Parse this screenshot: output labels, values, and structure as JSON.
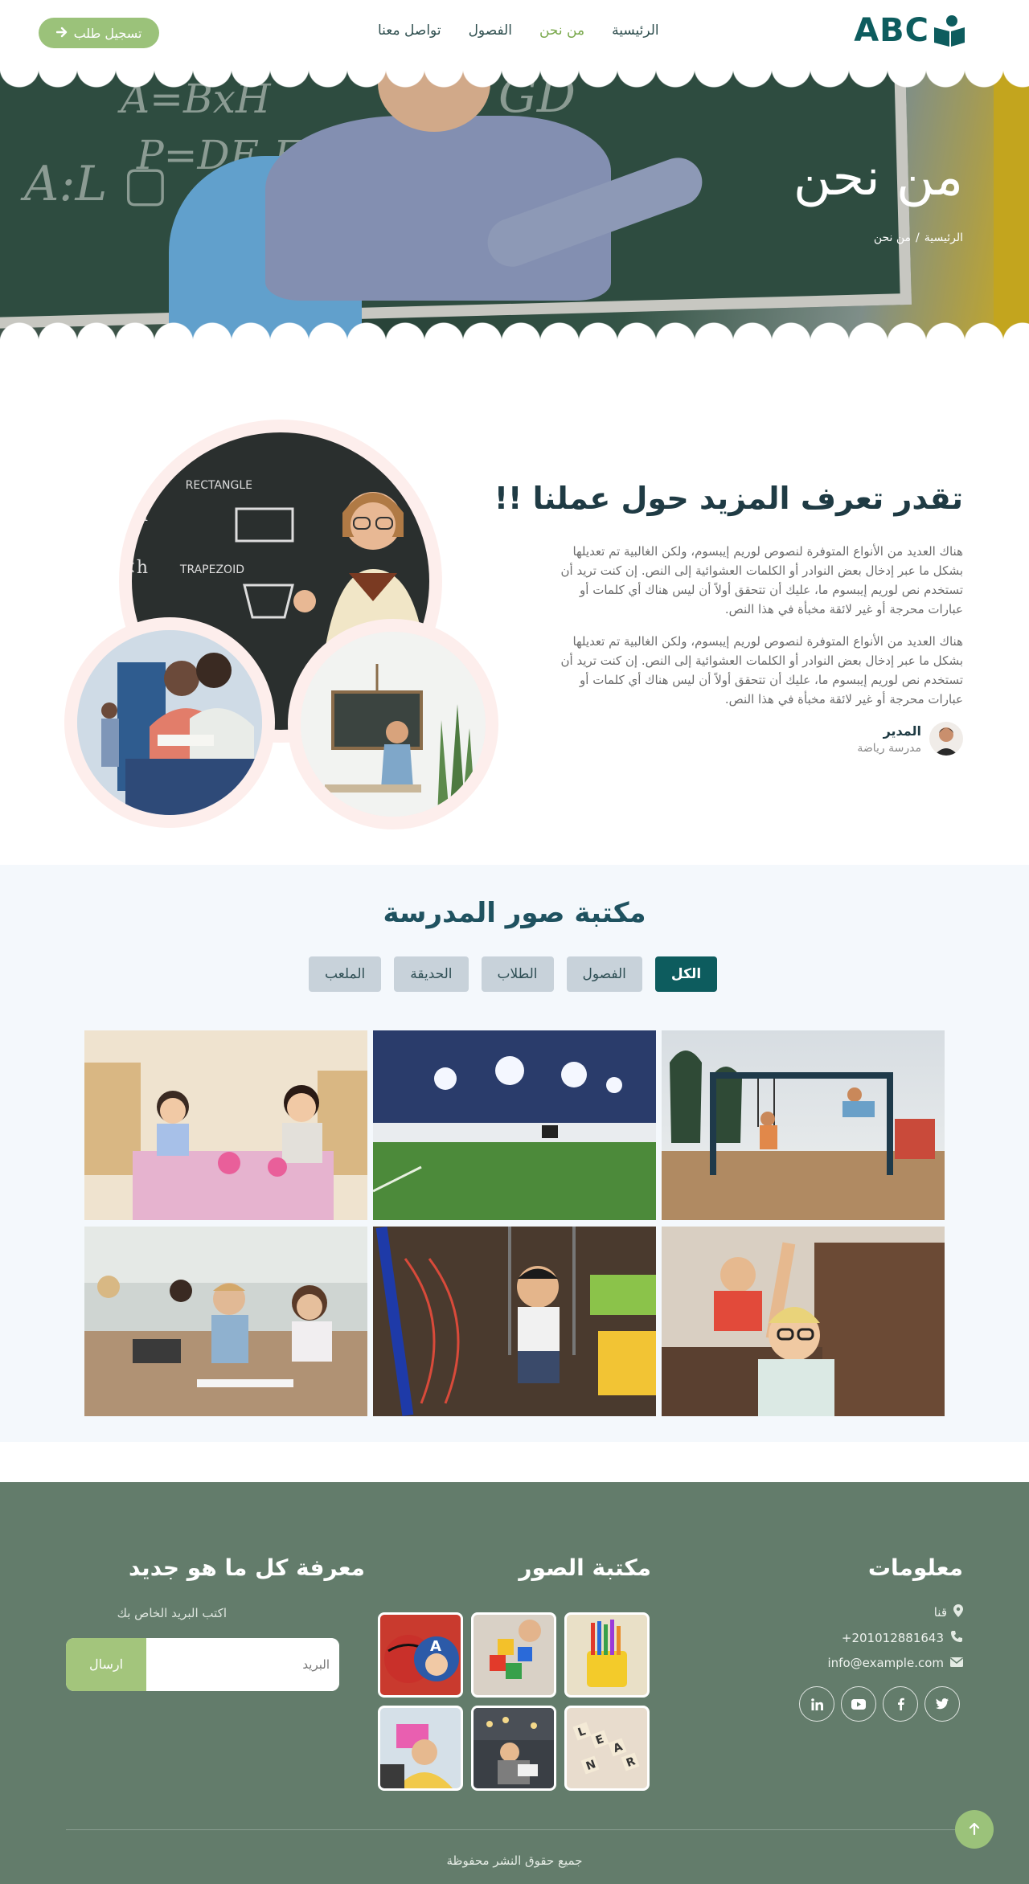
{
  "nav": {
    "logo_text": "ABC",
    "items": [
      {
        "label": "الرئيسية",
        "active": false
      },
      {
        "label": "من نحن",
        "active": true
      },
      {
        "label": "الفصول",
        "active": false
      },
      {
        "label": "تواصل معنا",
        "active": false
      }
    ],
    "cta_label": "تسجيل طلب"
  },
  "hero": {
    "title": "من نحن",
    "breadcrumb": {
      "home": "الرئيسية",
      "separator": "/",
      "current": "من نحن"
    }
  },
  "about": {
    "title": "تقدر تعرف المزيد حول عملنا !!",
    "paragraphs": [
      "هناك العديد من الأنواع المتوفرة لنصوص لوريم إيبسوم، ولكن الغالبية تم تعديلها بشكل ما عبر إدخال بعض النوادر أو الكلمات العشوائية إلى النص. إن كنت تريد أن تستخدم نص لوريم إيبسوم ما، عليك أن تتحقق أولاً أن ليس هناك أي كلمات أو عبارات محرجة أو غير لائقة مخبأة في هذا النص.",
      "هناك العديد من الأنواع المتوفرة لنصوص لوريم إيبسوم، ولكن الغالبية تم تعديلها بشكل ما عبر إدخال بعض النوادر أو الكلمات العشوائية إلى النص. إن كنت تريد أن تستخدم نص لوريم إيبسوم ما، عليك أن تتحقق أولاً أن ليس هناك أي كلمات أو عبارات محرجة أو غير لائقة مخبأة في هذا النص."
    ],
    "manager": {
      "name": "المدير",
      "role": "مدرسة رياضة"
    }
  },
  "gallery": {
    "title": "مكتبة صور المدرسة",
    "filters": [
      {
        "label": "الكل",
        "active": true
      },
      {
        "label": "الفصول",
        "active": false
      },
      {
        "label": "الطلاب",
        "active": false
      },
      {
        "label": "الحديقة",
        "active": false
      },
      {
        "label": "الملعب",
        "active": false
      }
    ]
  },
  "footer": {
    "info": {
      "title": "معلومات",
      "address": "قنا",
      "phone": "+201012881643",
      "email": "info@example.com",
      "social": [
        "twitter",
        "facebook",
        "youtube",
        "linkedin"
      ]
    },
    "photos_title": "مكتبة الصور",
    "newsletter": {
      "title": "معرفة كل ما هو جديد",
      "subtitle": "اكتب البريد الخاص بك",
      "placeholder": "البريد",
      "button": "ارسال"
    },
    "copyright": "جميع حقوق النشر محفوظة"
  },
  "colors": {
    "brand": "#0d5c5e",
    "accent": "#9bc27a",
    "footer_bg": "#637c6b",
    "gallery_bg": "#f4f8fc"
  }
}
